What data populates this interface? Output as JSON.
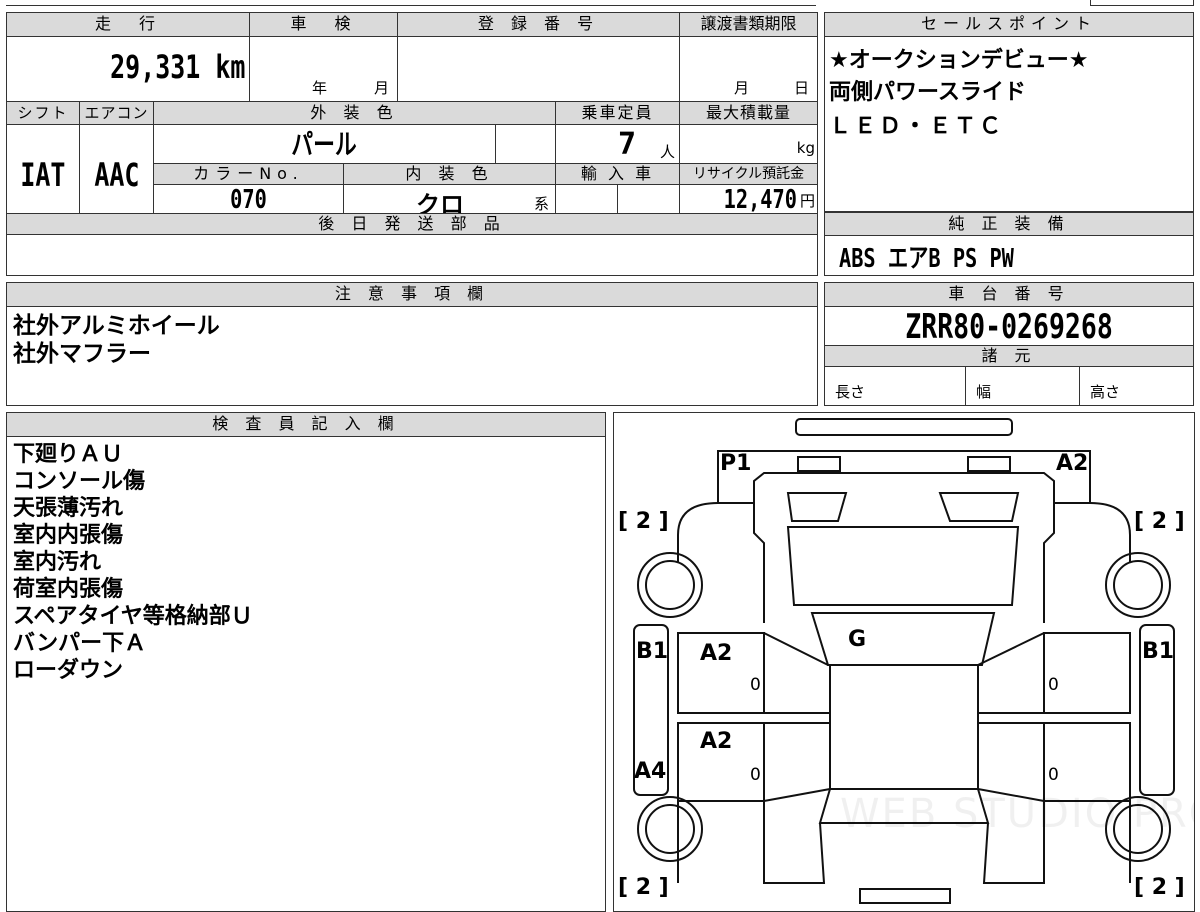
{
  "labels": {
    "mileage": "走　行",
    "shaken": "車　検",
    "reg_no": "登 録 番 号",
    "transfer_deadline": "譲渡書類期限",
    "sales_point": "セールスポイント",
    "shift": "シフト",
    "aircon": "エアコン",
    "exterior_color": "外 装 色",
    "capacity": "乗車定員",
    "max_load": "最大積載量",
    "color_no": "カラーNo.",
    "interior_color": "内 装 色",
    "import_car": "輸 入 車",
    "recycle_fee": "リサイクル預託金",
    "later_parts": "後 日 発 送 部 品",
    "genuine_equipment": "純 正 装 備",
    "caution": "注 意 事 項 欄",
    "chassis_no": "車 台 番 号",
    "specs": "諸 元",
    "length": "長さ",
    "width": "幅",
    "height": "高さ",
    "inspector": "検 査 員 記 入 欄",
    "year": "年",
    "month": "月",
    "day": "日",
    "person_unit": "人",
    "kg_unit": "kg",
    "yen_unit": "円",
    "kei": "系"
  },
  "vehicle": {
    "mileage": "29,331",
    "mileage_unit": "km",
    "shift": "IAT",
    "aircon": "AAC",
    "exterior_color": "パール",
    "capacity": "7",
    "color_no": "070",
    "interior_color": "クロ",
    "recycle_fee": "12,470",
    "chassis_no": "ZRR80-0269268"
  },
  "sales_points": [
    "★オークションデビュー★",
    "両側パワースライド",
    "ＬＥＤ・ＥＴＣ"
  ],
  "genuine_equipment": "ABS エアB PS PW",
  "cautions": [
    "社外アルミホイール",
    "社外マフラー"
  ],
  "inspector_notes": [
    "下廻りＡＵ",
    "コンソール傷",
    "天張薄汚れ",
    "室内内張傷",
    "室内汚れ",
    "荷室内張傷",
    "スペアタイヤ等格納部Ｕ",
    "バンパー下Ａ",
    "ローダウン"
  ],
  "diagram": {
    "p1": "P1",
    "a2_top": "A2",
    "g": "G",
    "b1_left": "B1",
    "b1_right": "B1",
    "a2_left_upper": "A2",
    "a2_left_lower": "A2",
    "a4": "A4",
    "zero_1": "0",
    "zero_2": "0",
    "zero_3": "0",
    "zero_4": "0",
    "bracket_tl": "[ 2 ]",
    "bracket_tr": "[ 2 ]",
    "bracket_bl": "[ 2 ]",
    "bracket_br": "[ 2 ]",
    "watermark": "WEB STUDIO PRO"
  }
}
